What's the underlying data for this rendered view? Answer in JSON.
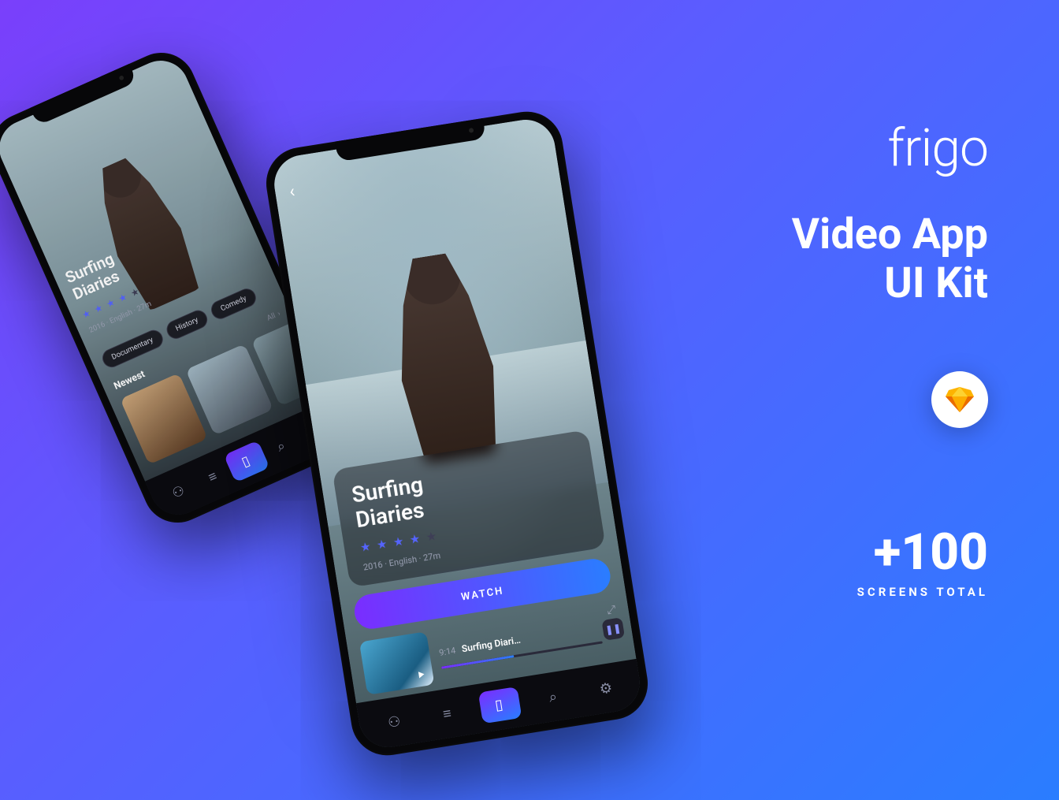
{
  "marketing": {
    "logo": "frigo",
    "headline_line1": "Video App",
    "headline_line2": "UI Kit",
    "stat_number": "+100",
    "stat_label": "SCREENS TOTAL"
  },
  "phone_b": {
    "hero_title_line1": "Surfing",
    "hero_title_line2": "Diaries",
    "rating": 4,
    "rating_max": 5,
    "meta": "2016 · English · 27m",
    "watch_label": "WATCH",
    "related": {
      "time": "9:14",
      "title": "Surfing Diari…",
      "progress_pct": 45
    },
    "tabs": [
      "profile",
      "list",
      "home",
      "search",
      "settings"
    ],
    "active_tab": 2
  },
  "phone_a": {
    "hero_title_line1": "Surfing",
    "hero_title_line2": "Diaries",
    "rating": 4,
    "rating_max": 5,
    "meta": "2016 · English · 27m",
    "categories": [
      "Documentary",
      "History",
      "Comedy"
    ],
    "section_title": "Newest",
    "section_all": "All",
    "tabs": [
      "profile",
      "list",
      "home",
      "search",
      "settings"
    ],
    "active_tab": 2
  },
  "colors": {
    "gradient_start": "#7a3ffb",
    "gradient_end": "#2a7dff",
    "accent_start": "#7a2dff",
    "accent_end": "#2a7dff"
  }
}
